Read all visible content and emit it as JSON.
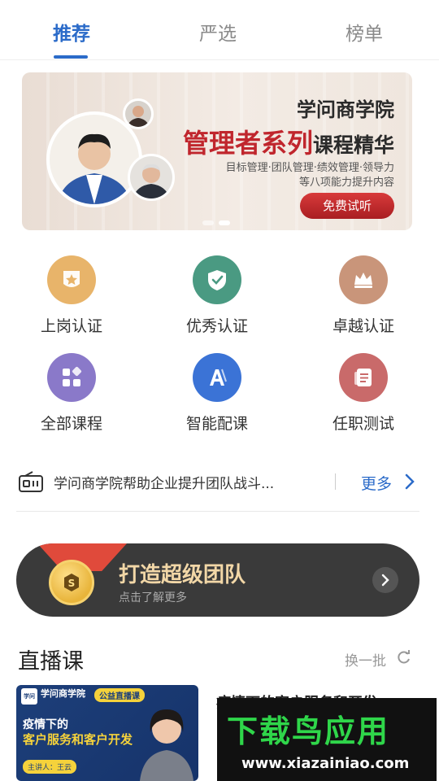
{
  "tabs": [
    {
      "label": "推荐",
      "active": true
    },
    {
      "label": "严选",
      "active": false
    },
    {
      "label": "榜单",
      "active": false
    }
  ],
  "banner": {
    "brand": "学问商学院",
    "title_red": "管理者系列",
    "title_dark": "课程精华",
    "subtitle_line1": "目标管理·团队管理·绩效管理·领导力",
    "subtitle_line2": "等八项能力提升内容",
    "cta": "免费试听",
    "slides": 2,
    "active_slide": 2
  },
  "categories": [
    {
      "label": "上岗认证",
      "icon": "badge-star-icon",
      "color": "#e8b46a"
    },
    {
      "label": "优秀认证",
      "icon": "shield-check-icon",
      "color": "#4a9a82"
    },
    {
      "label": "卓越认证",
      "icon": "crown-icon",
      "color": "#c9957a"
    },
    {
      "label": "全部课程",
      "icon": "grid-icon",
      "color": "#8a79c9"
    },
    {
      "label": "智能配课",
      "icon": "ai-letter-icon",
      "color": "#3b73d6"
    },
    {
      "label": "任职测试",
      "icon": "document-icon",
      "color": "#c96a6a"
    }
  ],
  "notice": {
    "text": "学问商学院帮助企业提升团队战斗...",
    "more": "更多"
  },
  "promo": {
    "title": "打造超级团队",
    "subtitle": "点击了解更多"
  },
  "live": {
    "title": "直播课",
    "refresh": "换一批",
    "card": {
      "logo": "学问",
      "brand": "学问商学院",
      "tag": "公益直播课",
      "line1": "疫情下的",
      "line2": "客户服务和客户开发",
      "speaker": "主讲人：王云"
    },
    "info_title": "疫情下的客户服务和开发"
  },
  "watermark": {
    "big": "下载鸟应用",
    "small": "www.xiazainiao.com"
  }
}
